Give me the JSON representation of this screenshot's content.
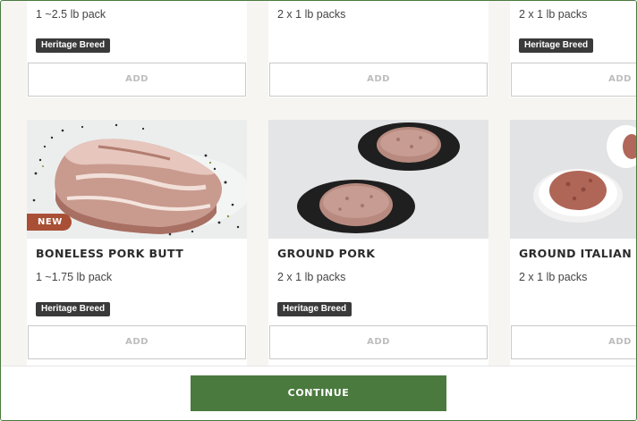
{
  "top_row": [
    {
      "size": "1 ~2.5 lb pack",
      "badge": "Heritage Breed",
      "add_label": "ADD"
    },
    {
      "size": "2 x 1 lb packs",
      "badge": "",
      "add_label": "ADD"
    },
    {
      "size": "2 x 1 lb packs",
      "badge": "Heritage Breed",
      "add_label": "ADD"
    }
  ],
  "products": [
    {
      "tag": "NEW",
      "title": "BONELESS PORK BUTT",
      "size": "1 ~1.75 lb pack",
      "badge": "Heritage Breed",
      "add_label": "ADD"
    },
    {
      "tag": "",
      "title": "GROUND PORK",
      "size": "2 x 1 lb packs",
      "badge": "Heritage Breed",
      "add_label": "ADD"
    },
    {
      "tag": "",
      "title": "GROUND ITALIAN PO",
      "size": "2 x 1 lb packs",
      "badge": "",
      "add_label": "ADD"
    }
  ],
  "footer": {
    "continue_label": "CONTINUE"
  },
  "colors": {
    "brand_green": "#4a7a3e",
    "new_tag": "#a84f35",
    "badge": "#3a3a3a"
  }
}
